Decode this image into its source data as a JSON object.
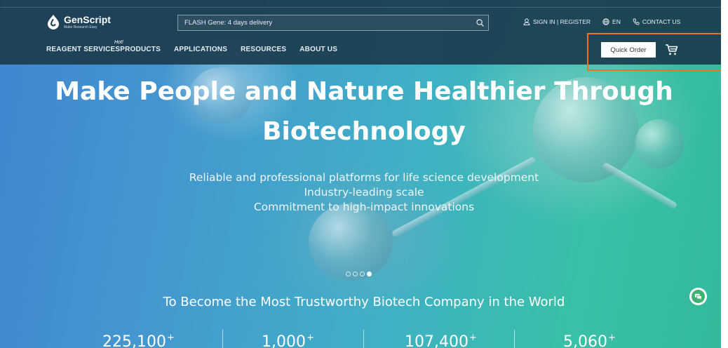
{
  "brand": {
    "name": "GenScript",
    "tagline": "Make Research Easy"
  },
  "search": {
    "placeholder": "FLASH Gene: 4 days delivery"
  },
  "top_links": {
    "sign_in": "SIGN IN | REGISTER",
    "language": "EN",
    "contact": "CONTACT US"
  },
  "nav": {
    "items": [
      {
        "label": "REAGENT SERVICES"
      },
      {
        "label": "PRODUCTS"
      },
      {
        "label": "APPLICATIONS"
      },
      {
        "label": "RESOURCES"
      },
      {
        "label": "ABOUT US"
      }
    ],
    "hot_badge": "Hot!"
  },
  "header_actions": {
    "quick_order": "Quick Order",
    "cart_icon": "cart-icon"
  },
  "hero": {
    "title": "Make People and Nature Healthier Through Biotechnology",
    "subtitle_lines": [
      "Reliable and professional platforms for life science development",
      "Industry-leading scale",
      "Commitment to high-impact innovations"
    ],
    "slides_total": 4,
    "slide_active": 4
  },
  "mission": "To Become the Most Trustworthy Biotech Company in the World",
  "stats": [
    {
      "value": "225,100",
      "suffix": "+"
    },
    {
      "value": "1,000",
      "suffix": "+"
    },
    {
      "value": "107,400",
      "suffix": "+"
    },
    {
      "value": "5,060",
      "suffix": "+"
    }
  ],
  "colors": {
    "header_bg": "#1b3c4e",
    "highlight_outline": "#e8742a",
    "chat_green": "#3cb371"
  }
}
